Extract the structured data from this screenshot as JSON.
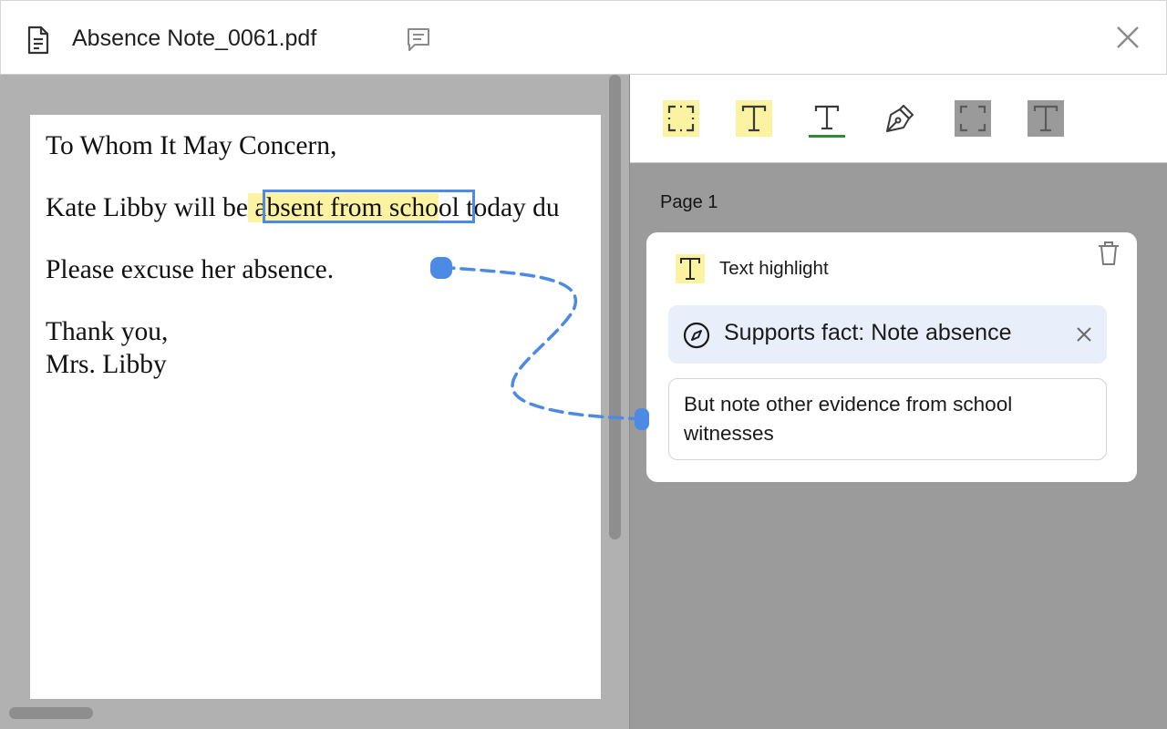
{
  "window": {
    "title": "Absence Note_0061.pdf",
    "icons": {
      "document": "document-icon",
      "comment": "comment-icon",
      "close": "close-icon"
    }
  },
  "document": {
    "lines": [
      "To Whom It May Concern,",
      "Please excuse her absence.",
      "Thank you,",
      "Mrs. Libby"
    ],
    "line2": {
      "before": "Kate Libby will be",
      "highlighted": " absent from scho",
      "after": "ol today du"
    },
    "highlight_color": "#fbf3a2",
    "selection_color": "#4c8ae3"
  },
  "toolbar": {
    "tools": [
      {
        "name": "area-highlight-tool",
        "icon": "area-select-icon"
      },
      {
        "name": "text-highlight-tool",
        "icon": "text-icon"
      },
      {
        "name": "text-underline-tool",
        "icon": "text-underline-icon"
      },
      {
        "name": "pen-tool",
        "icon": "pen-icon"
      },
      {
        "name": "area-redact-tool",
        "icon": "area-select-icon"
      },
      {
        "name": "text-redact-tool",
        "icon": "text-icon"
      }
    ],
    "underline_color": "#2e8b3a"
  },
  "annotations": {
    "page_label": "Page 1",
    "card": {
      "type_label": "Text highlight",
      "fact_label": "Supports fact: Note absence",
      "note": "But note other evidence from school witnesses"
    }
  },
  "colors": {
    "accent": "#4c8ae3",
    "chip_background": "#e8eefa",
    "viewer_background": "#b1b1b1",
    "panel_background": "#9b9b9b"
  }
}
